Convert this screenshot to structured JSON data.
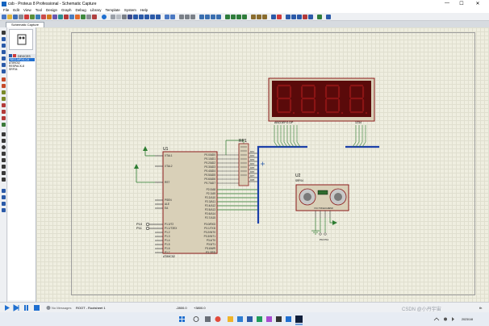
{
  "window": {
    "title": "csb - Proteus 8 Professional - Schematic Capture",
    "minimize": "—",
    "maximize": "☐",
    "close": "✕"
  },
  "menu": [
    "File",
    "Edit",
    "View",
    "Tool",
    "Design",
    "Graph",
    "Debug",
    "Library",
    "Template",
    "System",
    "Help"
  ],
  "tab": {
    "label": "Schematic Capture"
  },
  "side": {
    "devices_label": "DEVICES",
    "devices": [
      "7SEG-MPX4-CA",
      "AT89C52",
      "RESPACK-8",
      "SRF04"
    ],
    "selected": 0
  },
  "schematic": {
    "u1_ref": "U1",
    "u1_part": "AT89C52",
    "u1_left_pins": [
      "XTAL1",
      "XTAL2",
      "RST",
      "PSEN",
      "ALE",
      "EA",
      "P1.0/T2",
      "P1.1/T2EX",
      "P1.2",
      "P1.3",
      "P1.4",
      "P1.5",
      "P1.6",
      "P1.7"
    ],
    "u1_right_pins": [
      "P0.0/AD0",
      "P0.1/AD1",
      "P0.2/AD2",
      "P0.3/AD3",
      "P0.4/AD4",
      "P0.5/AD5",
      "P0.6/AD6",
      "P0.7/AD7",
      "P2.0/A8",
      "P2.1/A9",
      "P2.2/A10",
      "P2.3/A11",
      "P2.4/A12",
      "P2.5/A13",
      "P2.6/A14",
      "P2.7/A15",
      "P3.0/RXD",
      "P3.1/TXD",
      "P3.2/INT0",
      "P3.3/INT1",
      "P3.4/T0",
      "P3.5/T1",
      "P3.6/WR",
      "P3.7/RD"
    ],
    "u1_left_nums": [
      "19",
      "18",
      "9",
      "29",
      "30",
      "31",
      "1",
      "2",
      "3",
      "4",
      "5",
      "6",
      "7",
      "8"
    ],
    "rp1_ref": "RP1",
    "rp1_pins": [
      "RP1",
      "RP2",
      "RP3",
      "RP4",
      "RP5",
      "RP6",
      "RP7",
      "RP8"
    ],
    "p10_label": "P10",
    "p11_label": "P11",
    "display_seg_label": "ABCDEFG DP",
    "display_digit_label": "1234",
    "u2_ref": "U2",
    "u2_part": "SRF04",
    "u2_pins": [
      "VCC",
      "TRIG",
      "ECHO",
      "GND"
    ],
    "net_p10": "P10",
    "net_p11": "P11"
  },
  "status": {
    "messages": "No Messages",
    "sheet": "ROOT - Rootsheet 1",
    "coord_x": "-2800.0",
    "coord_y": "+3800.0",
    "unit": "th"
  },
  "taskbar": {
    "time": "2023/1/8",
    "watermark": "CSDN @小丹宇宙"
  },
  "colors": {
    "canvas": "#efeee0",
    "wire": "#2e7d32",
    "bus": "#1b3fa8",
    "component_fill": "#d9d0b8",
    "component_outline": "#8b1a1a",
    "display_bg": "#5a0a0a",
    "segment": "#8a1414"
  }
}
